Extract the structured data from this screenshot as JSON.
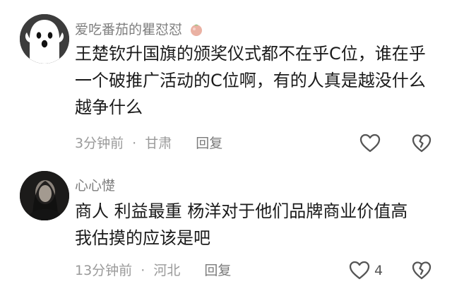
{
  "comments": [
    {
      "username": "爱吃番茄的瞿怼怼",
      "badge_icon": "tomato-icon",
      "text": "王楚钦升国旗的颁奖仪式都不在乎C位，谁在乎一个破推广活动的C位啊，有的人真是越没什么越争什么",
      "time": "3分钟前",
      "separator": "·",
      "location": "甘肃",
      "reply_label": "回复",
      "like_count": "",
      "icons": [
        "heart-outline-icon",
        "broken-heart-icon"
      ]
    },
    {
      "username": "心心憷",
      "text": "商人 利益最重 杨洋对于他们品牌商业价值高 我估摸的应该是吧",
      "time": "13分钟前",
      "separator": "·",
      "location": "河北",
      "reply_label": "回复",
      "like_count": "4",
      "icons": [
        "heart-outline-icon",
        "broken-heart-icon"
      ]
    }
  ],
  "colors": {
    "username": "#7e7e7e",
    "text": "#1a1a1a",
    "meta": "#9a9a9a",
    "icon_stroke": "#555555",
    "badge": "#e9a08f"
  }
}
